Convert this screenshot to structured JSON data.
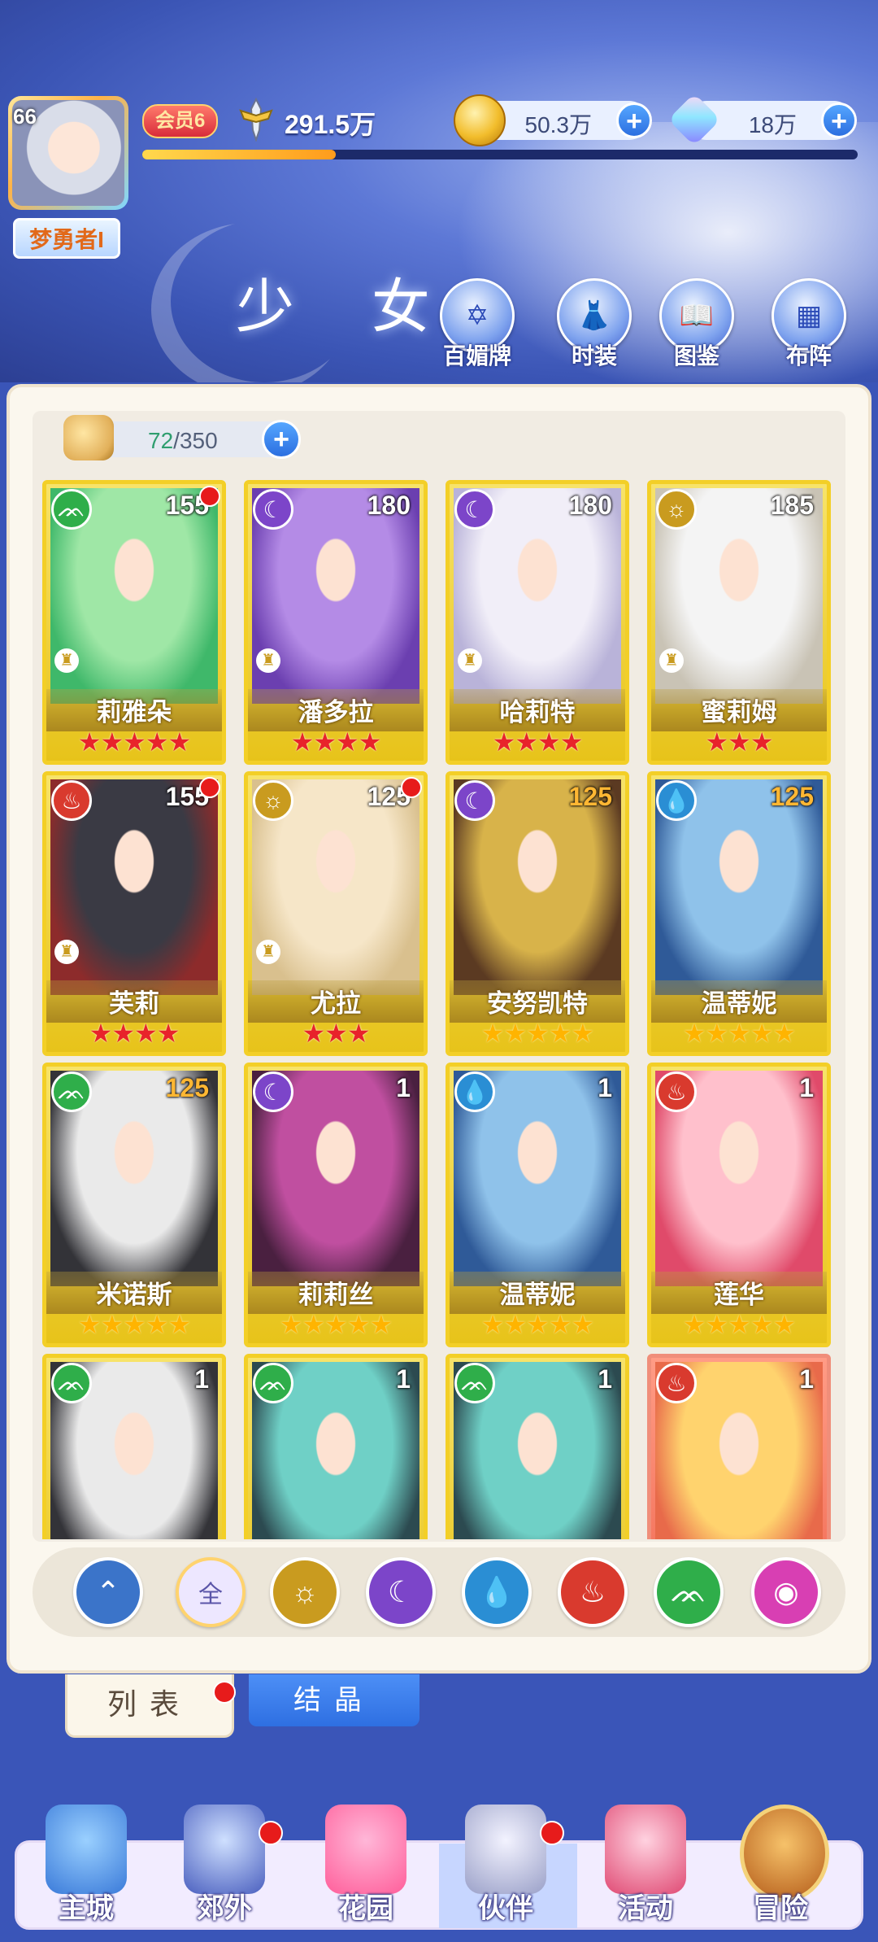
{
  "player": {
    "level": "66",
    "name": "梦勇者I",
    "vip": "会员6",
    "power": "291.5万",
    "exp_progress": 0.27
  },
  "resources": {
    "coins": "50.3万",
    "gems": "18万",
    "plus": "+"
  },
  "section_title": "少 女",
  "hero_buttons": [
    {
      "label": "百媚牌"
    },
    {
      "label": "时装"
    },
    {
      "label": "图鉴"
    },
    {
      "label": "布阵"
    }
  ],
  "storage": {
    "current": "72",
    "separator": "/",
    "max": "350"
  },
  "cards": [
    {
      "name": "莉雅朵",
      "level": "155",
      "element": "wind",
      "stars": 5,
      "star_color": "red",
      "dot": true,
      "rook": true
    },
    {
      "name": "潘多拉",
      "level": "180",
      "element": "moon",
      "stars": 4,
      "star_color": "red",
      "dot": false,
      "rook": true
    },
    {
      "name": "哈莉特",
      "level": "180",
      "element": "moon",
      "stars": 4,
      "star_color": "red",
      "dot": false,
      "rook": true
    },
    {
      "name": "蜜莉姆",
      "level": "185",
      "element": "sun",
      "stars": 3,
      "star_color": "red",
      "dot": false,
      "rook": true
    },
    {
      "name": "芙莉",
      "level": "155",
      "element": "fire",
      "stars": 4,
      "star_color": "red",
      "dot": true,
      "rook": true
    },
    {
      "name": "尤拉",
      "level": "125",
      "element": "sun",
      "stars": 3,
      "star_color": "red",
      "dot": true,
      "rook": true
    },
    {
      "name": "安努凯特",
      "level": "125",
      "element": "moon",
      "stars": 5,
      "star_color": "gold",
      "dot": false,
      "rook": false,
      "level_color": "orange"
    },
    {
      "name": "温蒂妮",
      "level": "125",
      "element": "water",
      "stars": 5,
      "star_color": "gold",
      "dot": false,
      "rook": false,
      "level_color": "orange"
    },
    {
      "name": "米诺斯",
      "level": "125",
      "element": "wind",
      "stars": 5,
      "star_color": "gold",
      "dot": false,
      "rook": false,
      "level_color": "orange"
    },
    {
      "name": "莉莉丝",
      "level": "1",
      "element": "moon",
      "stars": 5,
      "star_color": "gold",
      "dot": false,
      "rook": false
    },
    {
      "name": "温蒂妮",
      "level": "1",
      "element": "water",
      "stars": 5,
      "star_color": "gold",
      "dot": false,
      "rook": false
    },
    {
      "name": "莲华",
      "level": "1",
      "element": "fire",
      "stars": 5,
      "star_color": "gold",
      "dot": false,
      "rook": false
    },
    {
      "name": "",
      "level": "1",
      "element": "wind",
      "stars": 0,
      "star_color": "gold",
      "dot": false,
      "rook": false
    },
    {
      "name": "",
      "level": "1",
      "element": "wind",
      "stars": 0,
      "star_color": "gold",
      "dot": false,
      "rook": false
    },
    {
      "name": "",
      "level": "1",
      "element": "wind",
      "stars": 0,
      "star_color": "gold",
      "dot": false,
      "rook": false
    },
    {
      "name": "",
      "level": "1",
      "element": "fire",
      "stars": 0,
      "star_color": "gold",
      "dot": false,
      "rook": false,
      "red_card": true
    }
  ],
  "element_colors": {
    "wind": "#2fae4a",
    "moon": "#7c45c9",
    "sun": "#c99b1f",
    "fire": "#d93a2e",
    "water": "#2a8ed4",
    "heart": "#d83fb3"
  },
  "filters": [
    {
      "key": "up",
      "glyph": "⌃",
      "color": "#3b74c9"
    },
    {
      "key": "all",
      "glyph": "全",
      "color": "#ede7ff"
    },
    {
      "key": "sun",
      "glyph": "☼",
      "color": "#c99b1f"
    },
    {
      "key": "moon",
      "glyph": "☾",
      "color": "#7c45c9"
    },
    {
      "key": "water",
      "glyph": "💧",
      "color": "#2a8ed4"
    },
    {
      "key": "fire",
      "glyph": "♨",
      "color": "#d93a2e"
    },
    {
      "key": "wind",
      "glyph": "ᨏ",
      "color": "#2fae4a"
    },
    {
      "key": "heart",
      "glyph": "◉",
      "color": "#d83fb3"
    }
  ],
  "tabs": {
    "list": "列表",
    "crystal": "结晶"
  },
  "nav": [
    {
      "label": "主城",
      "dot": false
    },
    {
      "label": "郊外",
      "dot": true
    },
    {
      "label": "花园",
      "dot": false
    },
    {
      "label": "伙伴",
      "dot": true
    },
    {
      "label": "活动",
      "dot": false
    },
    {
      "label": "冒险",
      "dot": false
    }
  ]
}
